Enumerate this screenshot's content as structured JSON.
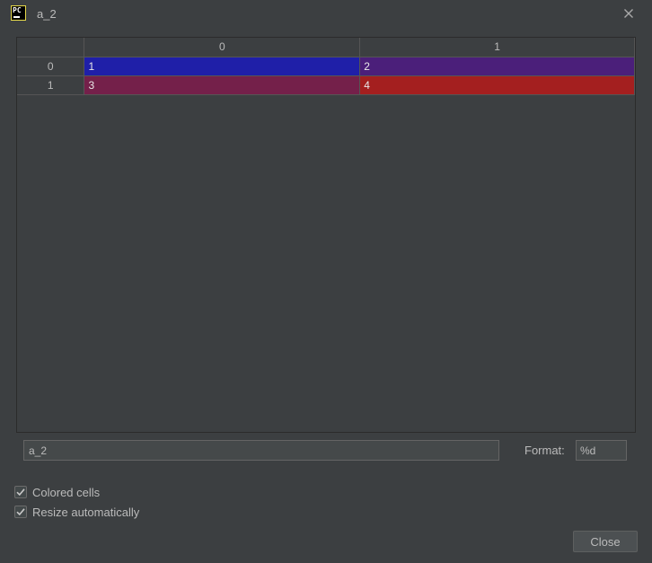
{
  "window": {
    "title": "a_2",
    "app_icon": "pycharm-logo-icon",
    "app_icon_text": "PC",
    "close_icon": "close-icon"
  },
  "table": {
    "columns": [
      "0",
      "1"
    ],
    "rows": [
      {
        "label": "0",
        "cells": [
          {
            "value": "1",
            "color": "#1f1fa8"
          },
          {
            "value": "2",
            "color": "#4b1f7a"
          }
        ]
      },
      {
        "label": "1",
        "cells": [
          {
            "value": "3",
            "color": "#74204a"
          },
          {
            "value": "4",
            "color": "#a41f1f"
          }
        ]
      }
    ]
  },
  "controls": {
    "name_value": "a_2",
    "format_label": "Format:",
    "format_value": "%d",
    "colored_cells": {
      "label": "Colored cells",
      "checked": true
    },
    "resize_auto": {
      "label": "Resize automatically",
      "checked": true
    },
    "close_label": "Close"
  }
}
